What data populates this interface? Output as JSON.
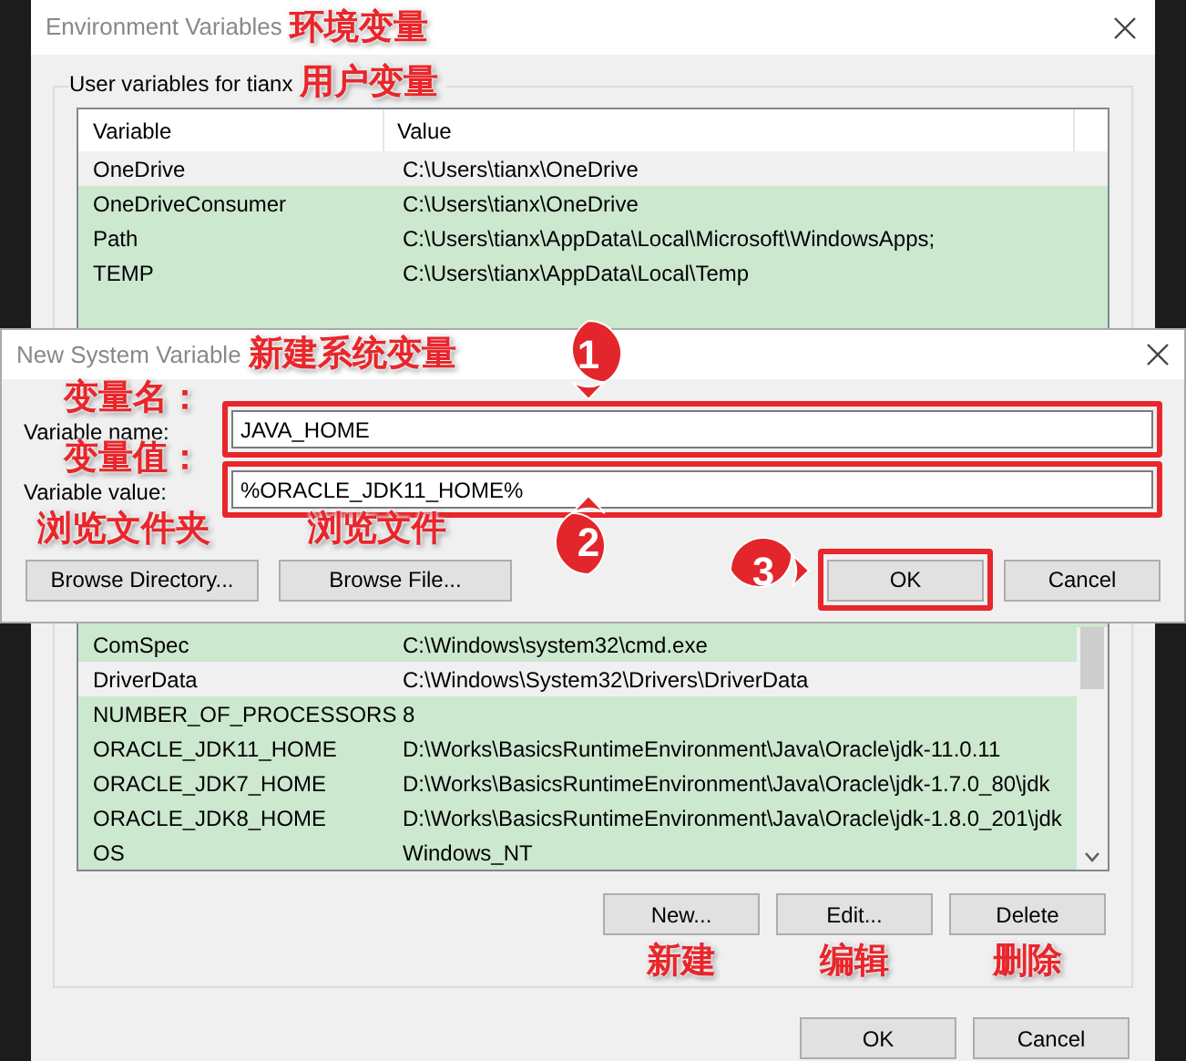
{
  "background_window": {
    "title": "Environment Variables",
    "title_note": "环境变量",
    "user_group": {
      "label": "User variables for tianx",
      "note": "用户变量",
      "columns": [
        "Variable",
        "Value"
      ],
      "rows": [
        {
          "variable": "OneDrive",
          "value": "C:\\Users\\tianx\\OneDrive",
          "highlighted": true
        },
        {
          "variable": "OneDriveConsumer",
          "value": "C:\\Users\\tianx\\OneDrive",
          "highlighted": false
        },
        {
          "variable": "Path",
          "value": "C:\\Users\\tianx\\AppData\\Local\\Microsoft\\WindowsApps;",
          "highlighted": false
        },
        {
          "variable": "TEMP",
          "value": "C:\\Users\\tianx\\AppData\\Local\\Temp",
          "highlighted": false
        }
      ]
    },
    "system_group": {
      "rows": [
        {
          "variable": "ComSpec",
          "value": "C:\\Windows\\system32\\cmd.exe",
          "highlighted": false
        },
        {
          "variable": "DriverData",
          "value": "C:\\Windows\\System32\\Drivers\\DriverData",
          "highlighted": true
        },
        {
          "variable": "NUMBER_OF_PROCESSORS",
          "value": "8",
          "highlighted": false
        },
        {
          "variable": "ORACLE_JDK11_HOME",
          "value": "D:\\Works\\BasicsRuntimeEnvironment\\Java\\Oracle\\jdk-11.0.11",
          "highlighted": false
        },
        {
          "variable": "ORACLE_JDK7_HOME",
          "value": "D:\\Works\\BasicsRuntimeEnvironment\\Java\\Oracle\\jdk-1.7.0_80\\jdk",
          "highlighted": false
        },
        {
          "variable": "ORACLE_JDK8_HOME",
          "value": "D:\\Works\\BasicsRuntimeEnvironment\\Java\\Oracle\\jdk-1.8.0_201\\jdk",
          "highlighted": false
        },
        {
          "variable": "OS",
          "value": "Windows_NT",
          "highlighted": false
        }
      ],
      "buttons": [
        {
          "label": "New...",
          "note": "新建"
        },
        {
          "label": "Edit...",
          "note": "编辑"
        },
        {
          "label": "Delete",
          "note": "删除"
        }
      ]
    },
    "buttons": [
      "OK",
      "Cancel"
    ]
  },
  "dialog": {
    "title": "New System Variable",
    "title_note": "新建系统变量",
    "fields": [
      {
        "label": "Variable name:",
        "note": "变量名：",
        "value": "JAVA_HOME",
        "annotated": true,
        "marker": "1"
      },
      {
        "label": "Variable value:",
        "note": "变量值：",
        "value": "%ORACLE_JDK11_HOME%",
        "annotated": true,
        "marker": "2"
      }
    ],
    "buttons": [
      {
        "label": "Browse Directory...",
        "note": "浏览文件夹",
        "annotated": false
      },
      {
        "label": "Browse File...",
        "note": "浏览文件",
        "annotated": false
      },
      {
        "label": "OK",
        "annotated": true,
        "marker": "3"
      },
      {
        "label": "Cancel",
        "annotated": false
      }
    ]
  }
}
